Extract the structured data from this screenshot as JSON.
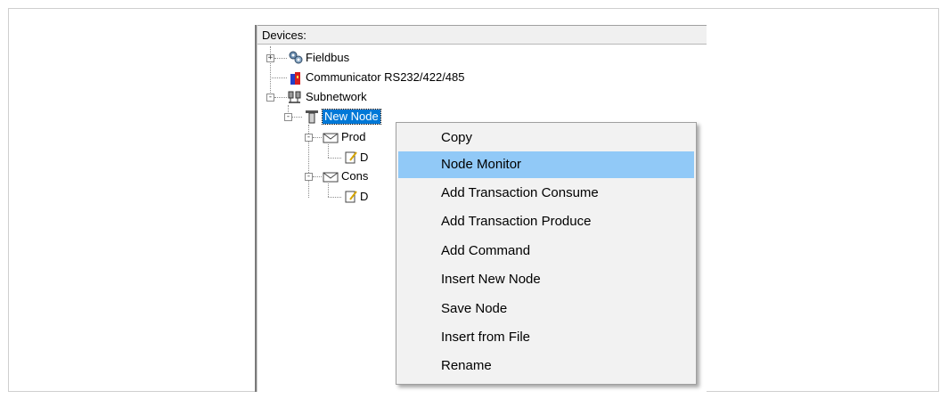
{
  "panel": {
    "header": "Devices:"
  },
  "tree": {
    "nodes": [
      {
        "label": "Fieldbus",
        "expander": "+",
        "icon": "fieldbus-icon"
      },
      {
        "label": "Communicator RS232/422/485",
        "icon": "communicator-icon"
      },
      {
        "label": "Subnetwork",
        "expander": "-",
        "icon": "subnetwork-icon"
      },
      {
        "label": "New Node",
        "expander": "-",
        "icon": "node-icon",
        "selected": true
      },
      {
        "label": "Prod",
        "expander": "-",
        "icon": "envelope-icon"
      },
      {
        "label": "D",
        "icon": "data-icon"
      },
      {
        "label": "Cons",
        "expander": "-",
        "icon": "envelope-icon"
      },
      {
        "label": "D",
        "icon": "data-icon"
      }
    ]
  },
  "context_menu": {
    "items": [
      {
        "label": "Copy"
      },
      {
        "label": "Node Monitor",
        "highlighted": true
      },
      {
        "label": "Add Transaction Consume"
      },
      {
        "label": "Add Transaction Produce"
      },
      {
        "label": "Add Command"
      },
      {
        "label": "Insert New Node"
      },
      {
        "label": "Save Node"
      },
      {
        "label": "Insert from File"
      },
      {
        "label": "Rename"
      }
    ]
  },
  "colors": {
    "selection": "#0078d7",
    "menu_highlight": "#91c9f7",
    "menu_background": "#f2f2f2"
  }
}
